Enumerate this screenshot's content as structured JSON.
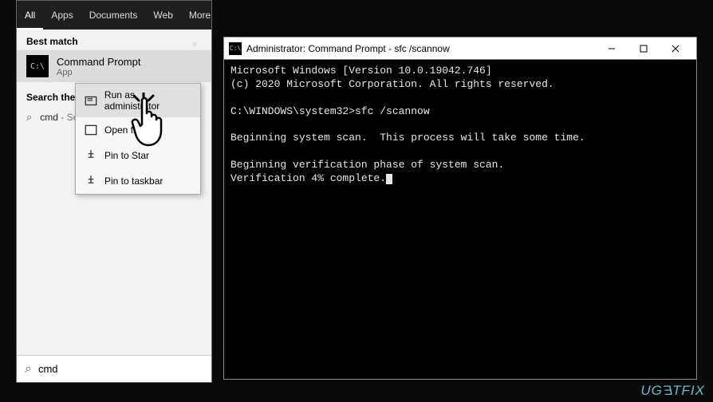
{
  "start": {
    "tabs": {
      "all": "All",
      "apps": "Apps",
      "documents": "Documents",
      "web": "Web",
      "more": "More"
    },
    "best_match_label": "Best match",
    "best_match": {
      "title": "Command Prompt",
      "subtitle": "App"
    },
    "search_web_label": "Search the web",
    "web_item": {
      "prefix": "cmd",
      "suffix": " - See"
    },
    "search_value": "cmd"
  },
  "context_menu": {
    "items": [
      {
        "label": "Run as administrator"
      },
      {
        "label": "Open file lo"
      },
      {
        "label": "Pin to Star"
      },
      {
        "label": "Pin to taskbar"
      }
    ]
  },
  "cmd": {
    "title": "Administrator: Command Prompt - sfc  /scannow",
    "lines": {
      "l1": "Microsoft Windows [Version 10.0.19042.746]",
      "l2": "(c) 2020 Microsoft Corporation. All rights reserved.",
      "l3": "",
      "l4": "C:\\WINDOWS\\system32>sfc /scannow",
      "l5": "",
      "l6": "Beginning system scan.  This process will take some time.",
      "l7": "",
      "l8": "Beginning verification phase of system scan.",
      "l9": "Verification 4% complete."
    }
  },
  "watermark": "UGETFIX"
}
